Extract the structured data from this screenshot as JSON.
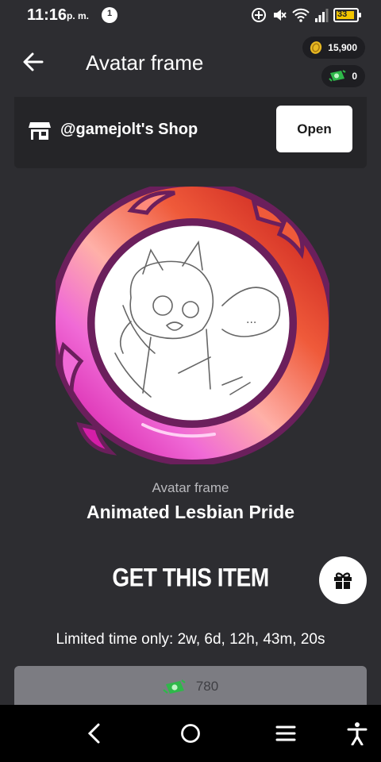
{
  "status_bar": {
    "time": "11:16",
    "ampm": "p. m.",
    "notification_count": "1",
    "battery_level": "33",
    "icons": [
      "add-circle-icon",
      "mute-icon",
      "wifi-icon",
      "signal-icon",
      "battery-icon"
    ]
  },
  "header": {
    "title": "Avatar frame",
    "coins": "15,900",
    "gems": "0"
  },
  "shop": {
    "name": "@gamejolt's Shop",
    "open_label": "Open"
  },
  "item": {
    "type": "Avatar frame",
    "name": "Animated Lesbian Pride",
    "doodle_text": "..."
  },
  "purchase": {
    "title": "GET THIS ITEM",
    "limited": "Limited time only: 2w, 6d, 12h, 43m, 20s",
    "price": "780"
  },
  "colors": {
    "background": "#2d2d31",
    "card": "#252528",
    "frame_outline": "#6b1f5c",
    "frame_orange": "#ef5a3a",
    "frame_pink": "#f06ad6",
    "frame_magenta": "#d51ea8",
    "price_button": "#7c7c82"
  },
  "nav": {
    "icons": [
      "back-nav-icon",
      "home-nav-icon",
      "recents-nav-icon",
      "accessibility-icon"
    ]
  }
}
